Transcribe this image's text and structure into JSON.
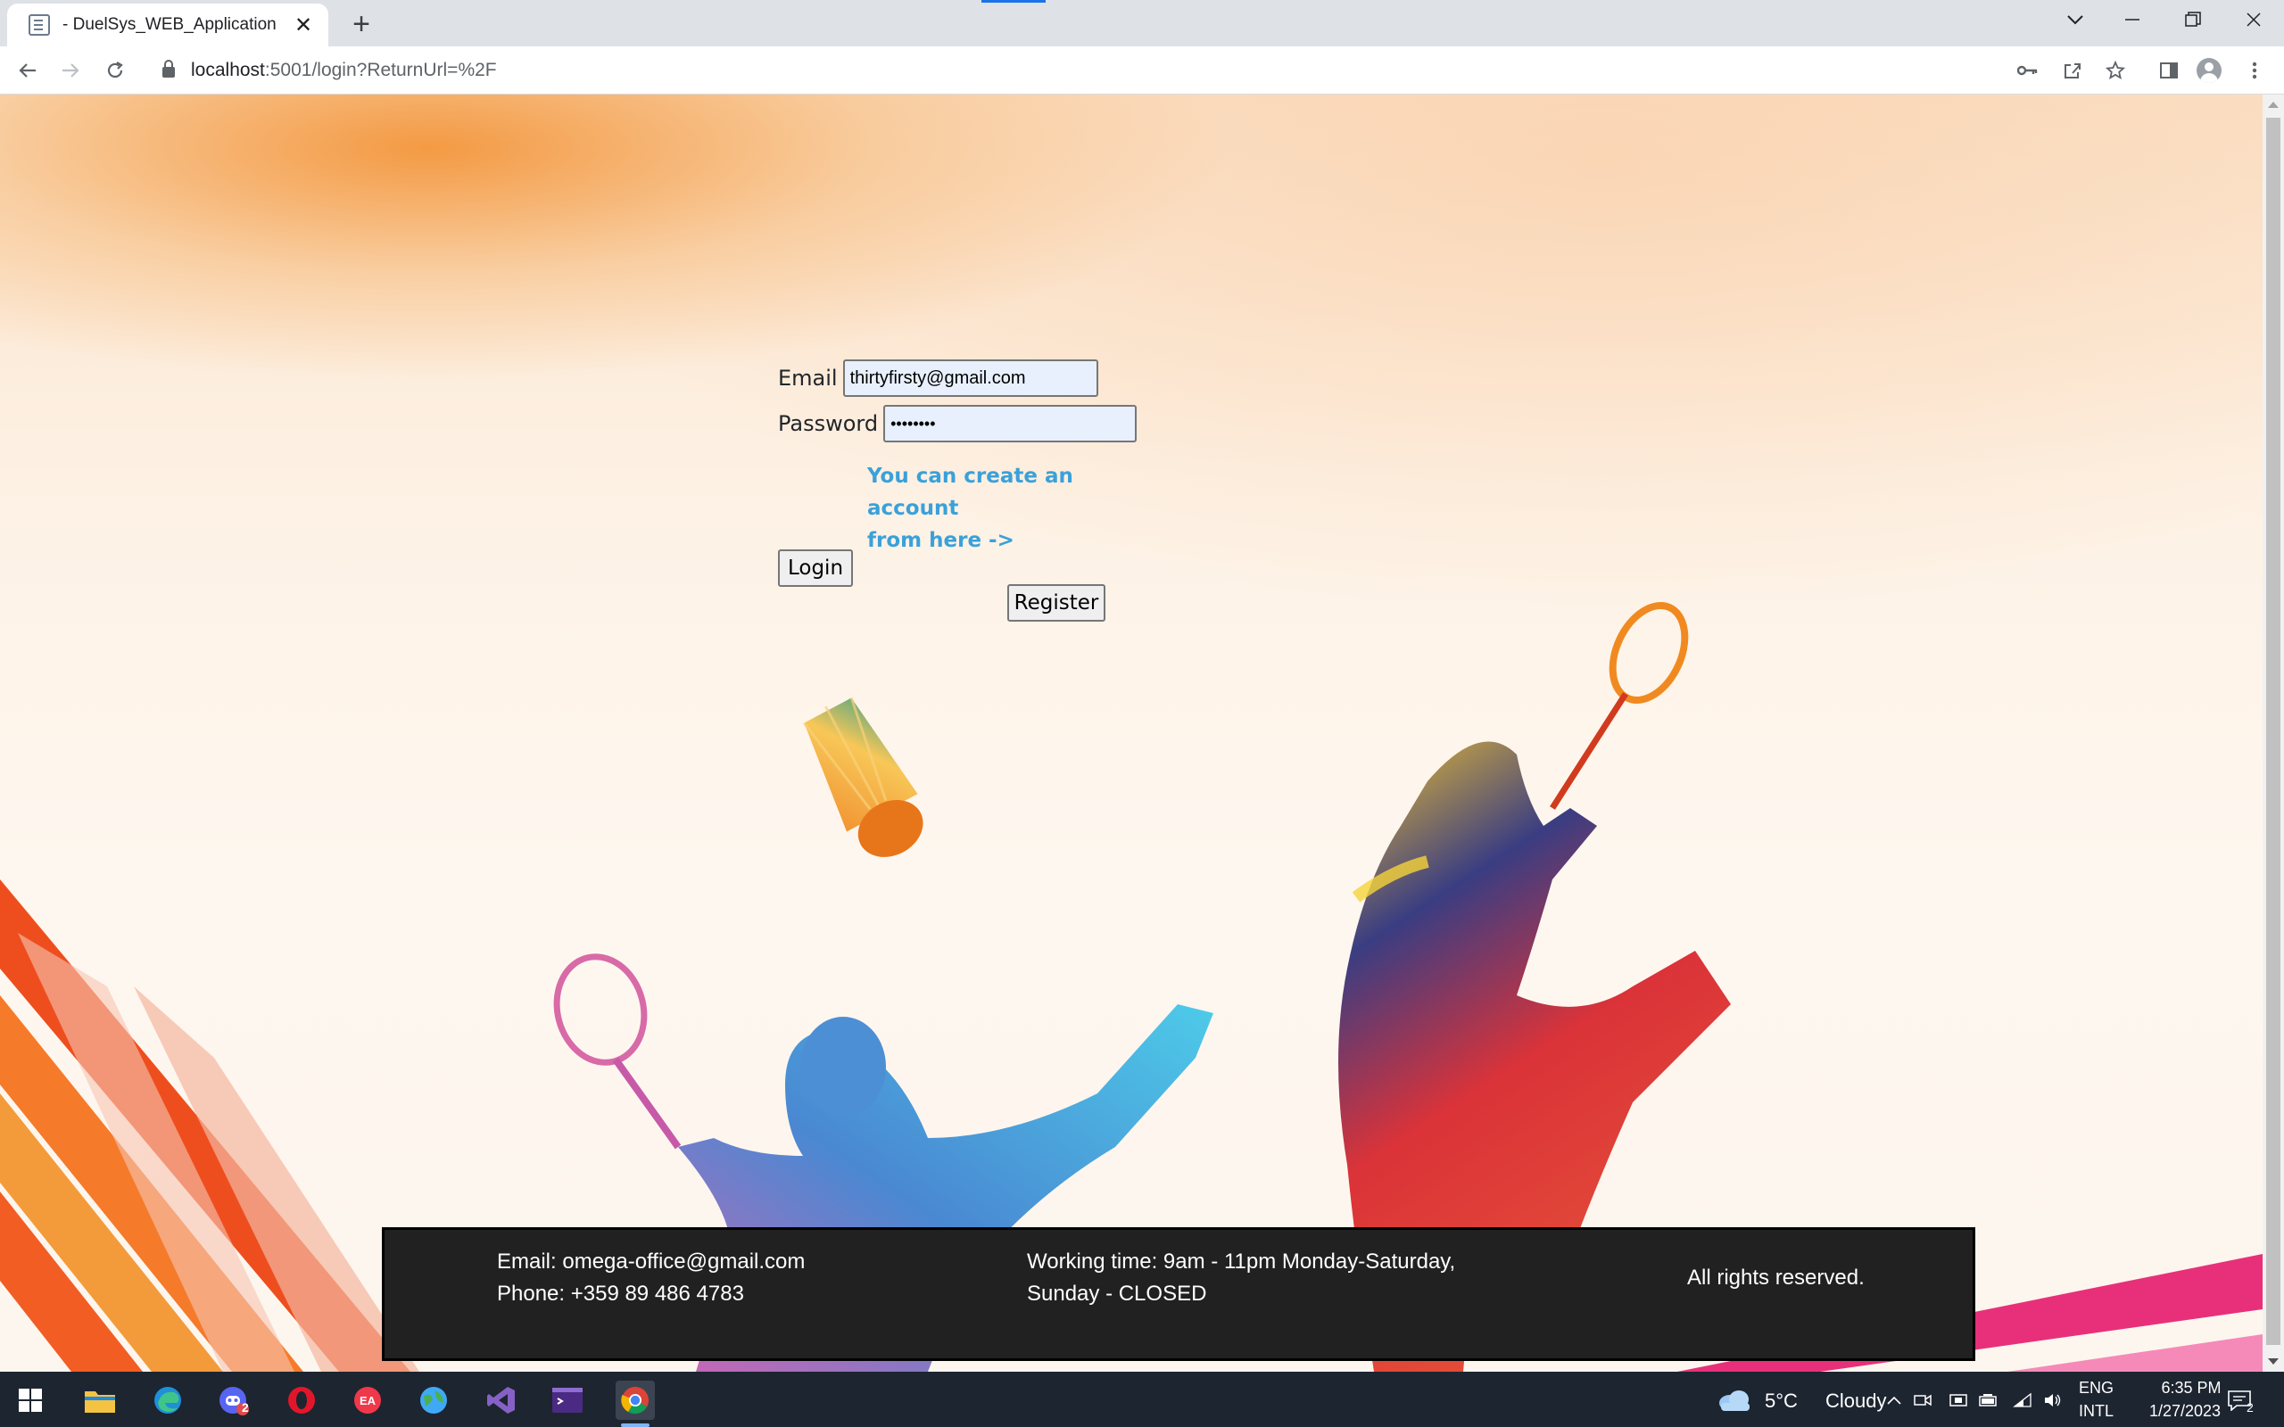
{
  "browser": {
    "tab_title": "- DuelSys_WEB_Application",
    "new_tab_symbol": "+",
    "url_host": "localhost",
    "url_path": ":5001/login?ReturnUrl=%2F"
  },
  "login": {
    "email_label": "Email",
    "email_value": "thirtyfirsty@gmail.com",
    "password_label": "Password",
    "password_value": "••••••••",
    "login_button": "Login",
    "register_hint_line1": "You can create an account",
    "register_hint_line2": "from here ->",
    "register_button": "Register"
  },
  "footer": {
    "email": "Email: omega-office@gmail.com",
    "phone": "Phone: +359 89 486 4783",
    "hours_line1": "Working time: 9am - 11pm Monday-Saturday,",
    "hours_line2": "Sunday - CLOSED",
    "rights": "All rights reserved."
  },
  "taskbar": {
    "apps": [
      "windows-start",
      "file-explorer",
      "edge",
      "discord",
      "opera",
      "ea-app",
      "browser-globe",
      "visual-studio",
      "terminal",
      "chrome"
    ],
    "discord_badge": "2",
    "weather_temp": "5°C",
    "weather_desc": "Cloudy",
    "lang_line1": "ENG",
    "lang_line2": "INTL",
    "time": "6:35 PM",
    "date": "1/27/2023",
    "notification_count": "2"
  },
  "colors": {
    "accent_link": "#3aa1d9",
    "footer_bg": "#212121",
    "input_autofill_bg": "#e8f0fe"
  }
}
